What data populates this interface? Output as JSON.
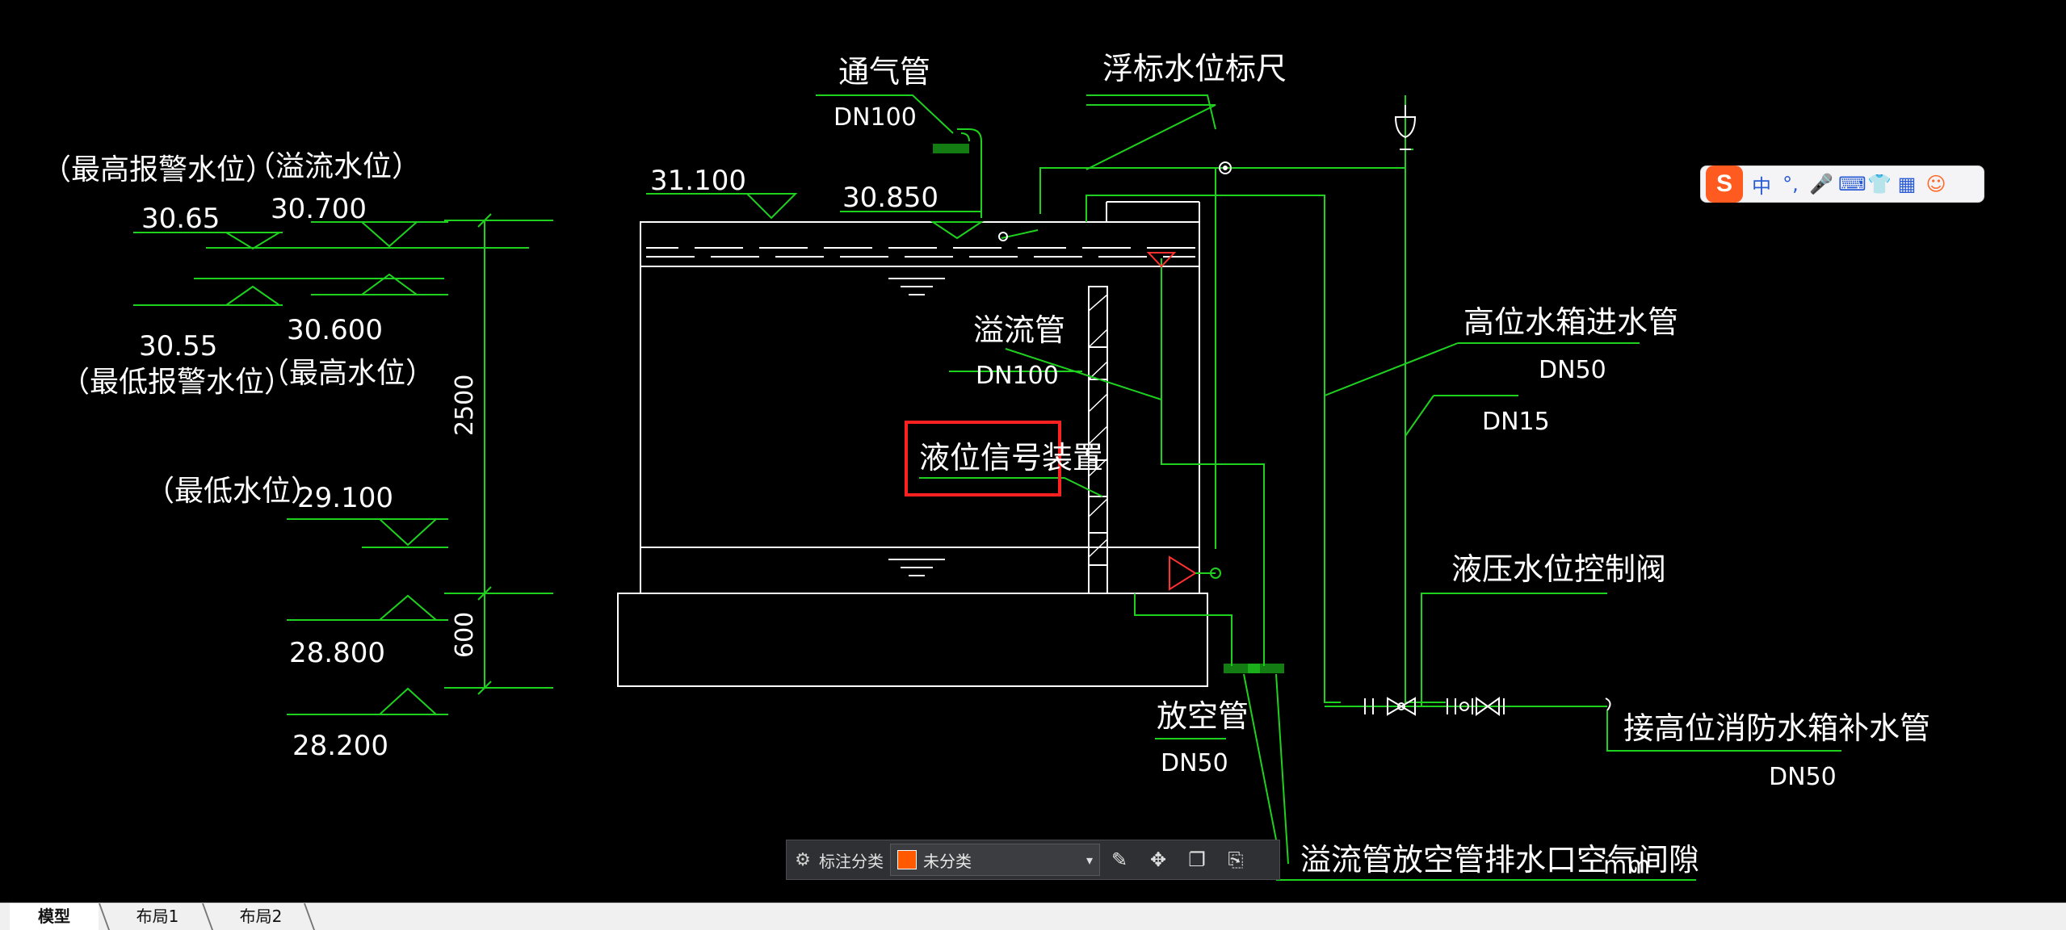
{
  "drawing": {
    "elevations_left": {
      "alarm_high_label": "（最高报警水位）",
      "alarm_high_value": "30.65",
      "overflow_label": "（溢流水位）",
      "overflow_value": "30.700",
      "alarm_low_value": "30.55",
      "alarm_low_label": "（最低报警水位）",
      "max_level_value": "30.600",
      "max_level_label": "（最高水位）",
      "min_level_label": "（最低水位）",
      "min_level_value": "29.100",
      "bottom_value": "28.800",
      "base_value": "28.200",
      "dim_upper": "2500",
      "dim_lower": "600"
    },
    "tank": {
      "top_elevation": "31.100",
      "water_elevation": "30.850"
    },
    "labels": {
      "vent_pipe": "通气管",
      "vent_pipe_size": "DN100",
      "float_gauge": "浮标水位标尺",
      "overflow_pipe": "溢流管",
      "overflow_pipe_size": "DN100",
      "level_signal": "液位信号装置",
      "inlet_pipe": "高位水箱进水管",
      "inlet_pipe_size": "DN50",
      "branch_size": "DN15",
      "hydraulic_valve": "液压水位控制阀",
      "makeup_pipe": "接高位消防水箱补水管",
      "makeup_pipe_size": "DN50",
      "drain_pipe": "放空管",
      "drain_pipe_size": "DN50",
      "outlet_note": "溢流管放空管排水口空气间隙",
      "outlet_note_suffix": "mm"
    }
  },
  "ime_toolbar": {
    "logo": "S",
    "items": [
      "中",
      "°,",
      "🎤",
      "⌨",
      "👕",
      "▦",
      "☺"
    ]
  },
  "annotation_toolbar": {
    "label": "标注分类",
    "selected": "未分类",
    "swatch_color": "#ff5a00"
  },
  "tabs": [
    "模型",
    "布局1",
    "布局2"
  ],
  "colors": {
    "green": "#1fd11f",
    "highlight": "#ff2020",
    "valve_red": "#ff3030",
    "background": "#000000"
  }
}
